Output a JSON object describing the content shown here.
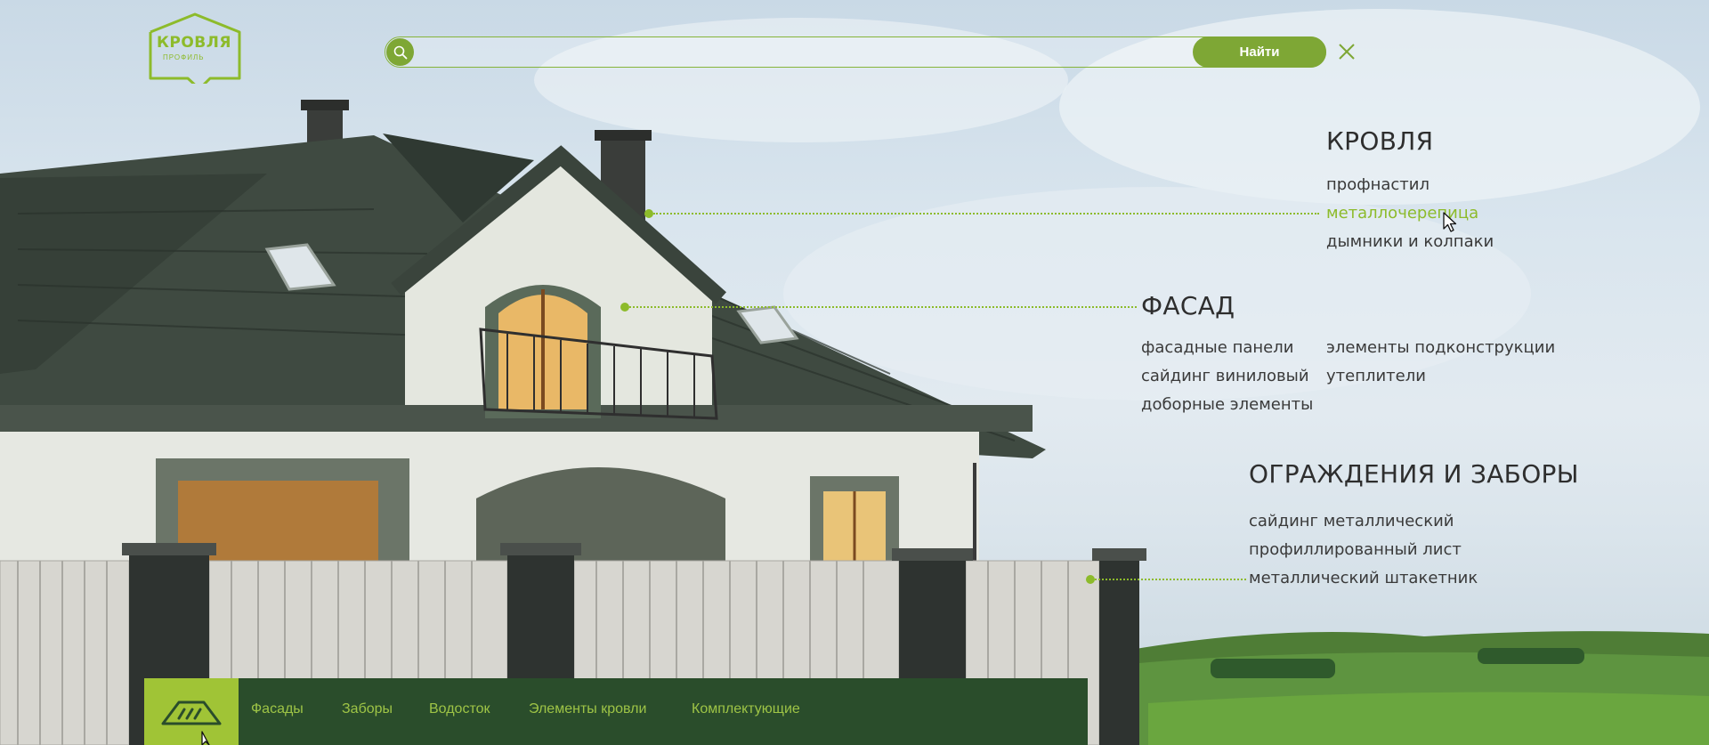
{
  "logo": {
    "text": "КРОВЛЯ",
    "subtext": "ПРОФИЛЬ"
  },
  "search": {
    "placeholder": "",
    "value": "",
    "button_label": "Найти"
  },
  "icons": {
    "search": "search-icon",
    "close": "close-icon",
    "home": "roof-icon"
  },
  "colors": {
    "accent": "#8dbb2b",
    "accent_dark": "#7ea735",
    "nav_bg": "#2a4d2b",
    "home_tile": "#a0c436",
    "nav_text": "#9ec446"
  },
  "menu": {
    "roof": {
      "title": "КРОВЛЯ",
      "links": [
        "профнастил",
        "металлочерепица",
        "дымники и колпаки"
      ],
      "active_link": "металлочерепица"
    },
    "facade": {
      "title": "ФАСАД",
      "col1": [
        "фасадные панели",
        "сайдинг виниловый",
        "доборные элементы"
      ],
      "col2": [
        "элементы подконструкции",
        "утеплители"
      ]
    },
    "fences": {
      "title": "ОГРАЖДЕНИЯ И ЗАБОРЫ",
      "links": [
        "сайдинг металлический",
        "профиллированный лист",
        "металлический штакетник"
      ]
    }
  },
  "bottom_nav": {
    "items": [
      "Фасады",
      "Заборы",
      "Водосток",
      "Элементы кровли",
      "Комплектующие"
    ]
  }
}
